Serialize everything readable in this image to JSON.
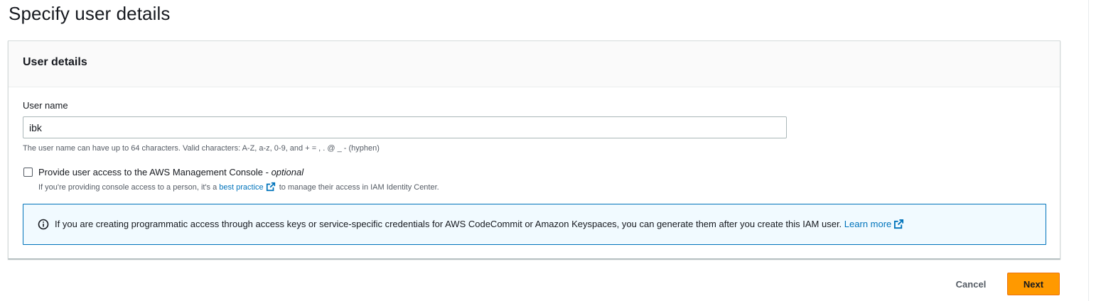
{
  "page": {
    "title": "Specify user details"
  },
  "panel": {
    "title": "User details",
    "user_name": {
      "label": "User name",
      "value": "ibk",
      "constraint": "The user name can have up to 64 characters. Valid characters: A-Z, a-z, 0-9, and + = , . @ _ - (hyphen)"
    },
    "console_access": {
      "checked": false,
      "label": "Provide user access to the AWS Management Console - ",
      "optional": "optional",
      "desc_before": "If you're providing console access to a person, it's a ",
      "desc_link": "best practice",
      "desc_after": " to manage their access in IAM Identity Center."
    },
    "info_alert": {
      "text": "If you are creating programmatic access through access keys or service-specific credentials for AWS CodeCommit or Amazon Keyspaces, you can generate them after you create this IAM user. ",
      "link": "Learn more"
    }
  },
  "actions": {
    "cancel": "Cancel",
    "next": "Next"
  },
  "icons": {
    "info": "info-icon",
    "external": "external-link-icon"
  },
  "colors": {
    "primary_button": "#ff9900",
    "link": "#0073bb",
    "alert_border": "#0073bb",
    "alert_bg": "#f1faff"
  }
}
